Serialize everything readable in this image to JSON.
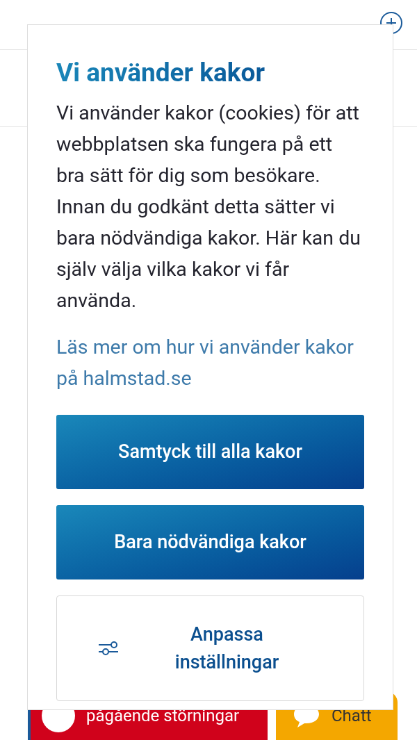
{
  "cookie_dialog": {
    "title": "Vi använder kakor",
    "body": "Vi använder kakor (cookies) för att webbplatsen ska fungera på ett bra sätt för dig som besökare. Innan du godkänt detta sätter vi bara nödvändiga kakor. Här kan du själv välja vilka kakor vi får använda.",
    "link": "Läs mer om hur vi använder kakor på halmstad.se",
    "buttons": [
      {
        "label": "Samtyck till alla kakor",
        "kind": "primary"
      },
      {
        "label": "Bara nödvändiga kakor",
        "kind": "primary"
      },
      {
        "label": "Anpassa inställningar",
        "kind": "settings"
      }
    ]
  },
  "bottom_bar": {
    "disruptions": "pågående störningar",
    "chat": "Chatt"
  }
}
